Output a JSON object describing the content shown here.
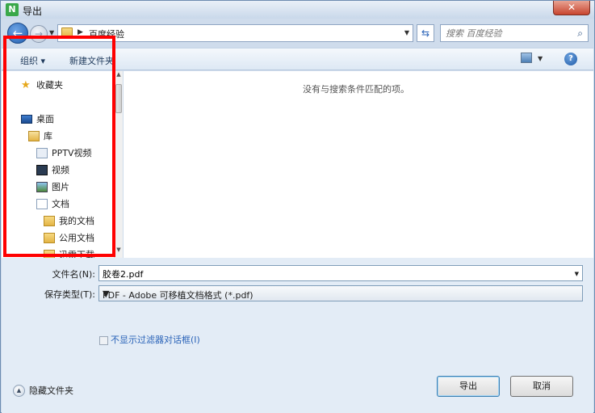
{
  "window": {
    "title": "导出",
    "app_icon_glyph": "N",
    "close_glyph": "✕"
  },
  "address_bar": {
    "breadcrumb": "百度经验",
    "search_placeholder": "搜索 百度经验"
  },
  "toolbar": {
    "organize_label": "组织 ▾",
    "new_folder_label": "新建文件夹"
  },
  "nav": {
    "favorites": "收藏夹",
    "desktop": "桌面",
    "libraries": "库",
    "pptv_video": "PPTV视频",
    "videos": "视频",
    "pictures": "图片",
    "documents": "文档",
    "my_documents": "我的文档",
    "public_documents": "公用文档",
    "partial_next": "迅雷下载"
  },
  "content": {
    "empty_message": "没有与搜索条件匹配的项。"
  },
  "form": {
    "filename_label": "文件名(N):",
    "filename_value": "胶卷2.pdf",
    "filetype_label": "保存类型(T):",
    "filetype_value": "PDF - Adobe 可移植文档格式 (*.pdf)",
    "no_filter_dialog_label": "不显示过滤器对话框(I)"
  },
  "footer": {
    "hide_folders_label": "隐藏文件夹",
    "export_button": "导出",
    "cancel_button": "取消"
  },
  "colors": {
    "highlight_box": "#ff0000",
    "link_blue": "#2a63b8"
  }
}
